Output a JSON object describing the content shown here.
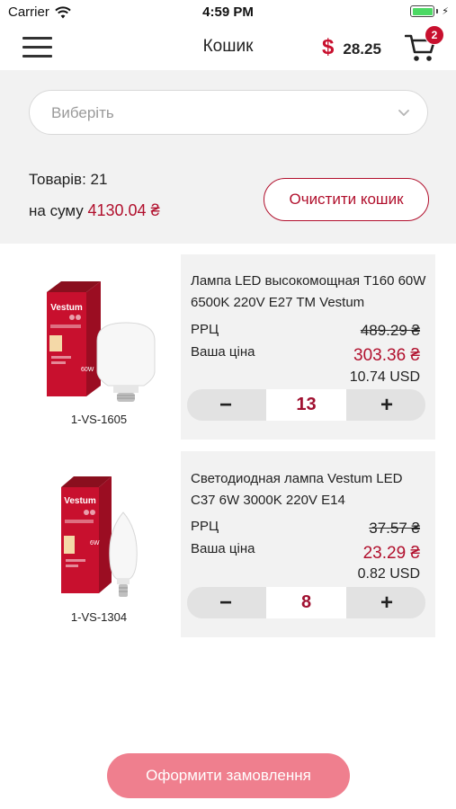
{
  "status_bar": {
    "carrier": "Carrier",
    "time": "4:59 PM"
  },
  "nav": {
    "title": "Кошик",
    "balance_currency": "$",
    "balance_value": "28.25",
    "cart_badge": "2"
  },
  "summary": {
    "select_placeholder": "Виберіть",
    "count_text": "Товарів: 21",
    "sum_label": "на суму",
    "sum_value": "4130.04 ₴",
    "clear_label": "Очистити кошик"
  },
  "items": [
    {
      "sku": "1-VS-1605",
      "name": "Лампа LED высокомощная T160 60W 6500K 220V E27 TM Vestum",
      "rrc_label": "РРЦ",
      "rrc_value": "489.29 ₴",
      "price_label": "Ваша ціна",
      "price_value": "303.36 ₴",
      "usd_value": "10.74 USD",
      "quantity": "13",
      "minus": "−",
      "plus": "+",
      "brand": "Vestum",
      "box_watts": "60W"
    },
    {
      "sku": "1-VS-1304",
      "name": "Светодиодная лампа Vestum LED C37  6W 3000K 220V E14",
      "rrc_label": "РРЦ",
      "rrc_value": "37.57 ₴",
      "price_label": "Ваша ціна",
      "price_value": "23.29 ₴",
      "usd_value": "0.82 USD",
      "quantity": "8",
      "minus": "−",
      "plus": "+",
      "brand": "Vestum",
      "box_watts": "6W"
    }
  ],
  "order_button": "Оформити замовлення",
  "colors": {
    "accent": "#b1102d",
    "order_button": "#ef7f8e",
    "panel": "#f2f2f2",
    "stepper": "#e2e2e2",
    "battery": "#4cd964"
  }
}
